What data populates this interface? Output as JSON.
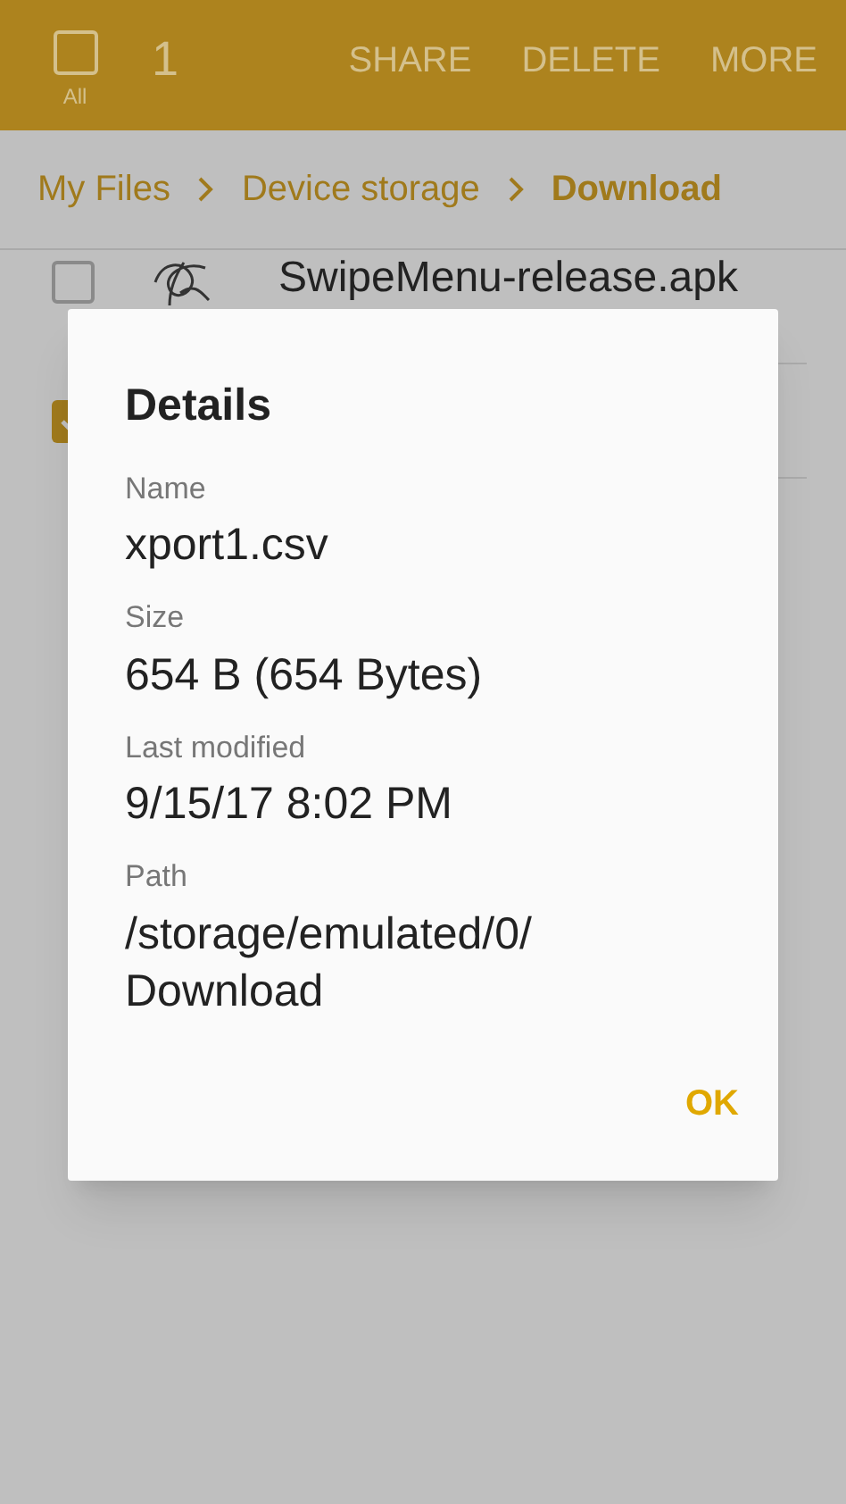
{
  "action_bar": {
    "select_all": {
      "label": "All",
      "checked": false
    },
    "count": "1",
    "actions": [
      "SHARE",
      "DELETE",
      "MORE"
    ]
  },
  "breadcrumb": [
    {
      "label": "My Files",
      "selected": false
    },
    {
      "label": "Device storage",
      "selected": false
    },
    {
      "label": "Download",
      "selected": true
    }
  ],
  "files": [
    {
      "name": "SwipeMenu-release.apk",
      "checked": false
    },
    {
      "checked": true
    }
  ],
  "dialog": {
    "title": "Details",
    "fields": [
      {
        "label": "Name",
        "value": "xport1.csv"
      },
      {
        "label": "Size",
        "value": "654 B (654 Bytes)"
      },
      {
        "label": "Last modified",
        "value": "9/15/17 8:02 PM"
      },
      {
        "label": "Path",
        "value": "/storage/emulated/0/ Download"
      }
    ],
    "button": "OK"
  }
}
